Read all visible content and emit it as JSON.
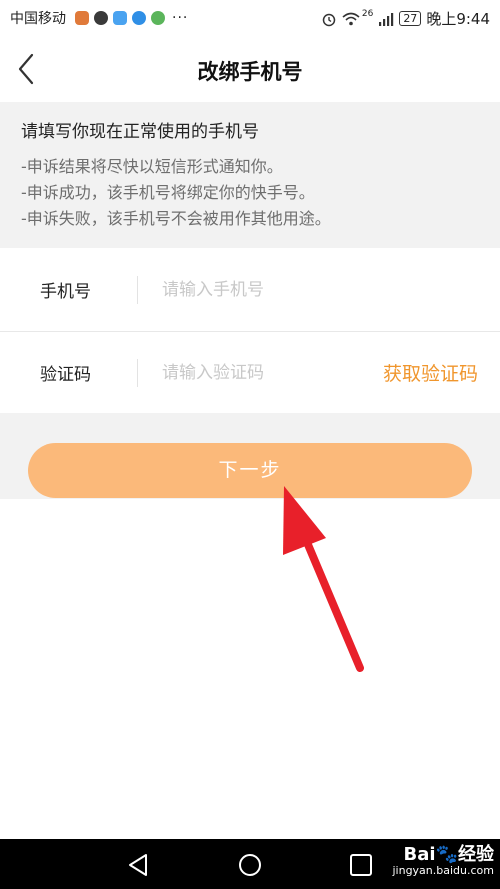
{
  "status_bar": {
    "carrier": "中国移动",
    "more": "···",
    "signal_text": "26",
    "battery": "27",
    "time": "晚上9:44",
    "app_icon_colors": [
      "#e07a3a",
      "#3a3a3a",
      "#4aa3f0",
      "#2f8fe6",
      "#5bb55b"
    ]
  },
  "header": {
    "title": "改绑手机号"
  },
  "notice": {
    "title": "请填写你现在正常使用的手机号",
    "lines": [
      "-申诉结果将尽快以短信形式通知你。",
      "-申诉成功，该手机号将绑定你的快手号。",
      "-申诉失败，该手机号不会被用作其他用途。"
    ]
  },
  "form": {
    "phone_label": "手机号",
    "phone_placeholder": "请输入手机号",
    "code_label": "验证码",
    "code_placeholder": "请输入验证码",
    "get_code_label": "获取验证码"
  },
  "next_button": {
    "label": "下一步"
  },
  "watermark": {
    "logo": "Bai🐾经验",
    "site": "jingyan.baidu.com"
  },
  "colors": {
    "accent": "#f0962d",
    "button_bg": "#fbb97a",
    "arrow": "#e8202a",
    "panel_bg": "#f2f2f2"
  }
}
